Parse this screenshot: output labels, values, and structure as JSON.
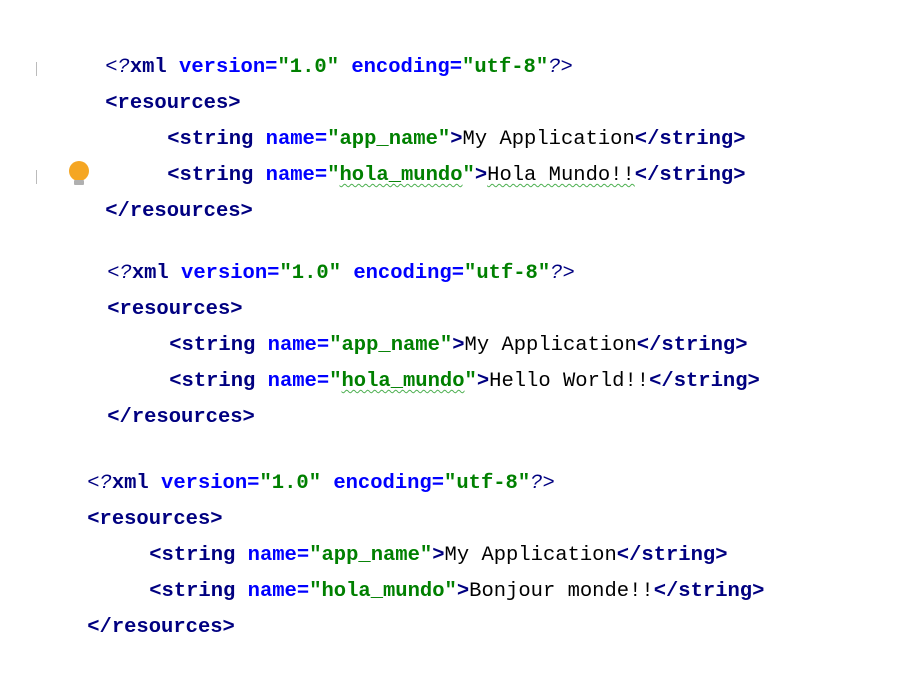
{
  "blocks": [
    {
      "decl": {
        "open": "<?",
        "xml": "xml",
        "version_attr": "version",
        "version_val": "\"1.0\"",
        "encoding_attr": "encoding",
        "encoding_val": "\"utf-8\"",
        "close": "?>"
      },
      "root_open": {
        "lt": "<",
        "tag": "resources",
        "gt": ">"
      },
      "strings": [
        {
          "lt": "<",
          "tag": "string",
          "name_attr": "name",
          "eq": "=",
          "name_val_q1": "\"",
          "name_val": "app_name",
          "name_val_q2": "\"",
          "gt": ">",
          "text": "My Application",
          "end_lt": "</",
          "end_tag": "string",
          "end_gt": ">"
        },
        {
          "lt": "<",
          "tag": "string",
          "name_attr": "name",
          "eq": "=",
          "name_val_q1": "\"",
          "name_val": "hola_mundo",
          "name_val_q2": "\"",
          "gt": ">",
          "text": "Hola Mundo!!",
          "end_lt": "</",
          "end_tag": "string",
          "end_gt": ">"
        }
      ],
      "root_close": {
        "lt": "</",
        "tag": "resources",
        "gt": ">"
      }
    },
    {
      "decl": {
        "open": "<?",
        "xml": "xml",
        "version_attr": "version",
        "version_val": "\"1.0\"",
        "encoding_attr": "encoding",
        "encoding_val": "\"utf-8\"",
        "close": "?>"
      },
      "root_open": {
        "lt": "<",
        "tag": "resources",
        "gt": ">"
      },
      "strings": [
        {
          "lt": "<",
          "tag": "string",
          "name_attr": "name",
          "eq": "=",
          "name_val_q1": "\"",
          "name_val": "app_name",
          "name_val_q2": "\"",
          "gt": ">",
          "text": "My Application",
          "end_lt": "</",
          "end_tag": "string",
          "end_gt": ">"
        },
        {
          "lt": "<",
          "tag": "string",
          "name_attr": "name",
          "eq": "=",
          "name_val_q1": "\"",
          "name_val": "hola_mundo",
          "name_val_q2": "\"",
          "gt": ">",
          "text": "Hello World!!",
          "end_lt": "</",
          "end_tag": "string",
          "end_gt": ">"
        }
      ],
      "root_close": {
        "lt": "</",
        "tag": "resources",
        "gt": ">"
      }
    },
    {
      "decl": {
        "open": "<?",
        "xml": "xml",
        "version_attr": "version",
        "version_val": "\"1.0\"",
        "encoding_attr": "encoding",
        "encoding_val": "\"utf-8\"",
        "close": "?>"
      },
      "root_open": {
        "lt": "<",
        "tag": "resources",
        "gt": ">"
      },
      "strings": [
        {
          "lt": "<",
          "tag": "string",
          "name_attr": "name",
          "eq": "=",
          "name_val_q1": "\"",
          "name_val": "app_name",
          "name_val_q2": "\"",
          "gt": ">",
          "text": "My Application",
          "end_lt": "</",
          "end_tag": "string",
          "end_gt": ">"
        },
        {
          "lt": "<",
          "tag": "string",
          "name_attr": "name",
          "eq": "=",
          "name_val_q1": "\"",
          "name_val": "hola_mundo",
          "name_val_q2": "\"",
          "gt": ">",
          "text": "Bonjour monde!!",
          "end_lt": "</",
          "end_tag": "string",
          "end_gt": ">"
        }
      ],
      "root_close": {
        "lt": "</",
        "tag": "resources",
        "gt": ">"
      }
    }
  ],
  "icons": {
    "intention_bulb": "lightbulb-icon"
  },
  "colors": {
    "tag": "#000080",
    "attr": "#0000ff",
    "value": "#008000",
    "bulb": "#f5a623"
  }
}
